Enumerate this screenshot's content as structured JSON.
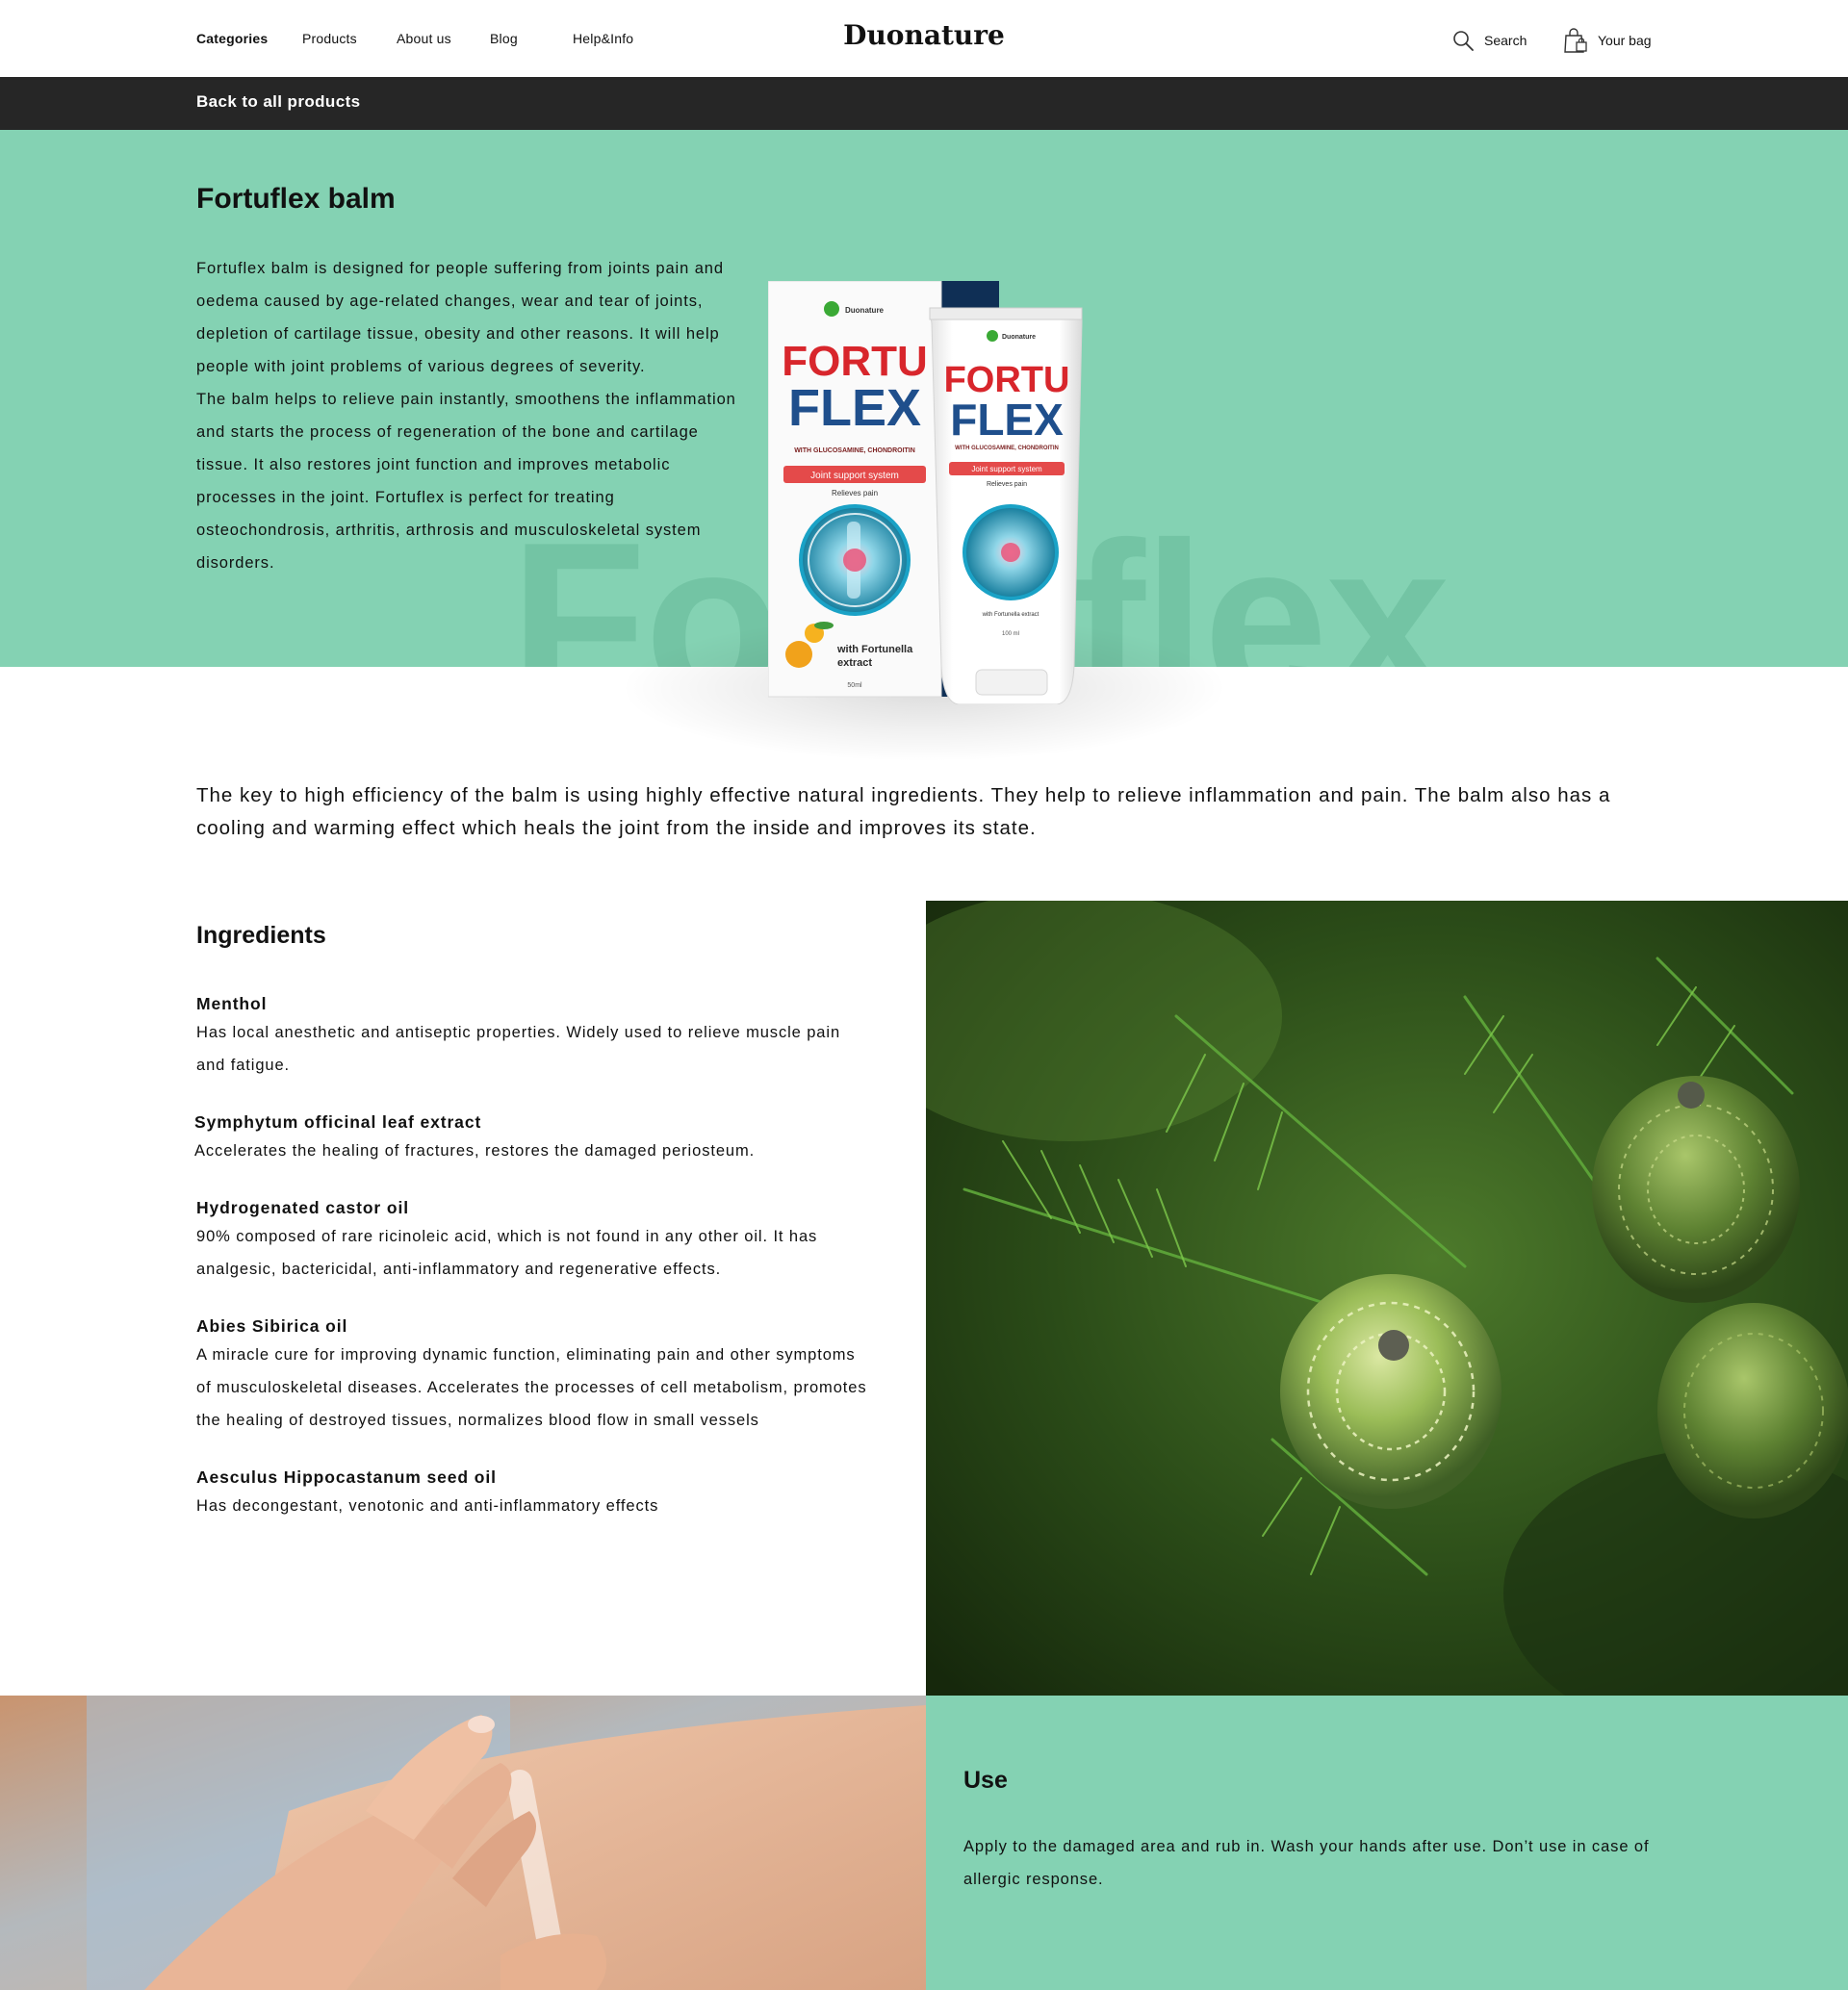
{
  "nav": {
    "categories": "Categories",
    "products": "Products",
    "about": "About us",
    "blog": "Blog",
    "help": "Help&Info"
  },
  "brand": "Duonature",
  "header": {
    "search_label": "Search",
    "bag_label": "Your bag",
    "search_icon": "search-icon",
    "bag_icon": "shopping-bag-icon"
  },
  "back_link": "Back to all products",
  "hero": {
    "title": "Fortuflex balm",
    "watermark": "Fortuflex",
    "paragraph_1": "Fortuflex balm is designed for people suffering from joints pain and oedema caused by age-related changes, wear and tear of joints, depletion of cartilage tissue, obesity and other reasons. It will help people with joint problems of various degrees of severity.",
    "paragraph_2": "The balm helps to relieve pain instantly, smoothens the inflammation and starts the process of regeneration of the bone and cartilage tissue. It also restores joint function and improves metabolic processes in the joint.  Fortuflex is perfect for treating osteochondrosis, arthritis, arthrosis and musculoskeletal system disorders."
  },
  "product_pack": {
    "brand": "Duonature",
    "name_line_1": "FORTU",
    "name_line_2": "FLEX",
    "subtitle": "WITH GLUCOSAMINE, CHONDROITIN",
    "banner": "Joint support system",
    "claim": "Relieves pain",
    "extract_line_1": "with Fortunella",
    "extract_line_2": "extract",
    "box_volume": "50ml",
    "tube_extract": "with Fortunella extract",
    "tube_volume": "100 ml"
  },
  "intro": "The key to high efficiency of the balm is using highly effective natural ingredients. They help to relieve inflammation and pain.  The balm also has a cooling and warming effect which heals the joint from the inside and improves its state.",
  "ingredients": {
    "title": "Ingredients",
    "items": [
      {
        "name": "Menthol",
        "desc": "Has local anesthetic and antiseptic properties. Widely used to relieve muscle pain and fatigue."
      },
      {
        "name": "Symphytum officinal leaf extract",
        "desc": "Accelerates the healing of fractures, restores the damaged periosteum."
      },
      {
        "name": "Hydrogenated castor oil",
        "desc": "90% composed of rare ricinoleic acid, which is not found in any other oil. It has analgesic, bactericidal, anti-inflammatory and regenerative effects."
      },
      {
        "name": "Abies Sibirica oil",
        "desc": "A miracle cure for improving dynamic function, eliminating pain and other symptoms of musculoskeletal diseases. Accelerates the processes of cell metabolism, promotes the healing of destroyed tissues, normalizes blood flow in small vessels"
      },
      {
        "name": "Aesculus Hippocastanum seed oil",
        "desc": "Has decongestant, venotonic and anti-inflammatory effects"
      }
    ]
  },
  "use": {
    "title": "Use",
    "text": "Apply to the damaged area and rub in. Wash your hands after use. Don’t use in case of allergic response."
  },
  "colors": {
    "mint": "#84d2b3",
    "dark_bar": "#262626",
    "brand_red": "#d8262c",
    "brand_blue": "#1f4f8c"
  }
}
